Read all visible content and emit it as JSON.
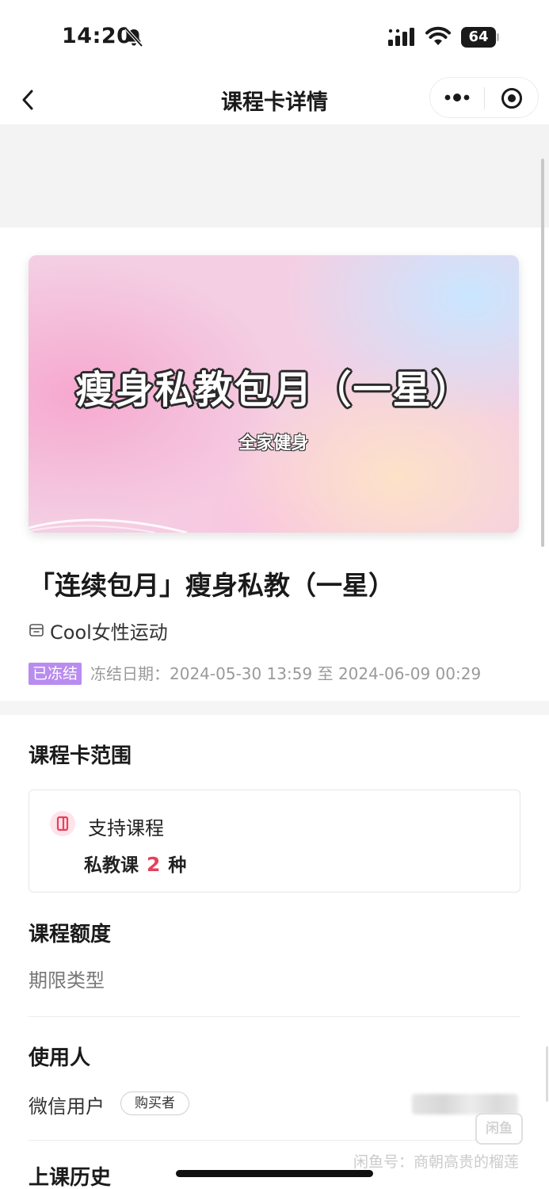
{
  "status_bar": {
    "time": "14:20",
    "battery_level": "64"
  },
  "nav": {
    "title": "课程卡详情"
  },
  "banner": {
    "title": "瘦身私教包月（一星）",
    "subtitle": "全家健身"
  },
  "course": {
    "title": "「连续包月」瘦身私教（一星）",
    "store": "Cool女性运动",
    "freeze_badge": "已冻结",
    "freeze_text": "冻结日期：2024-05-30 13:59 至 2024-06-09 00:29"
  },
  "scope": {
    "section_title": "课程卡范围",
    "support_label": "支持课程",
    "course_type": "私教课",
    "course_count": "2",
    "count_unit": "种"
  },
  "quota": {
    "section_title": "课程额度",
    "type_label": "期限类型"
  },
  "users": {
    "section_title": "使用人",
    "user_label": "微信用户",
    "buyer_tag": "购买者"
  },
  "history": {
    "section_title": "上课历史"
  },
  "watermark": {
    "logo_text": "闲鱼",
    "text": "闲鱼号：商朝高贵的榴莲"
  },
  "colors": {
    "freeze_badge": "#b98cf0",
    "count_accent": "#e8405a"
  }
}
